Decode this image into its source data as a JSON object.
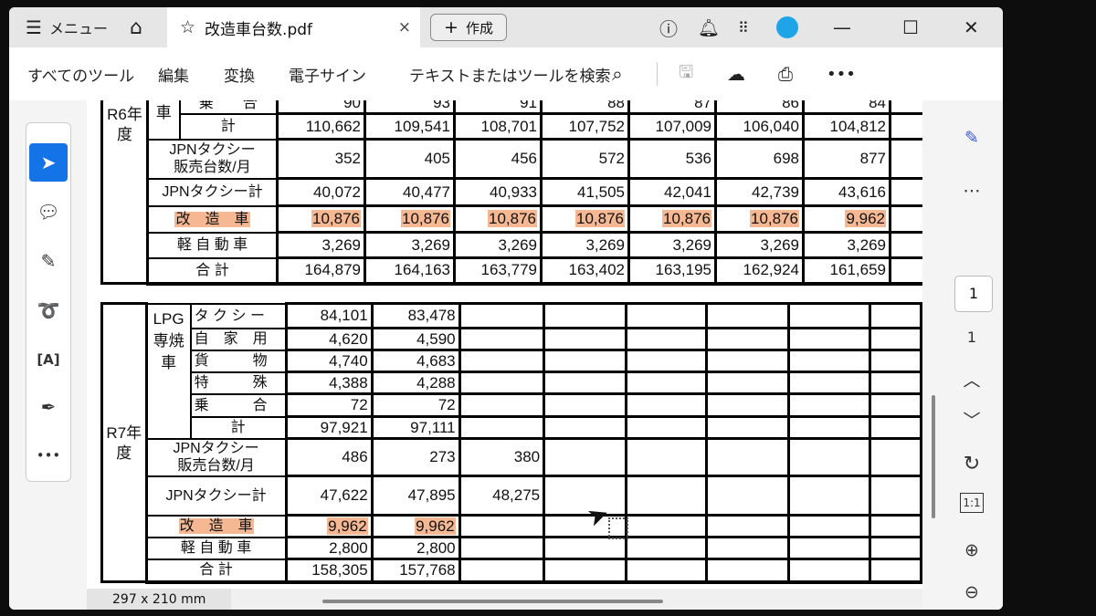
{
  "tabbar": {
    "menu_label": "メニュー",
    "tab_title": "改造車台数.pdf",
    "close": "×",
    "create_label": "作成"
  },
  "toolbar": {
    "all_tools": "すべてのツール",
    "edit": "編集",
    "convert": "変換",
    "esign": "電子サイン",
    "search_placeholder": "テキストまたはツールを検索"
  },
  "colors": {
    "accent": "#1473e6",
    "highlight": "#f6b892"
  },
  "r6": {
    "year_label": "R6年度",
    "sub_label": "車",
    "partial_row": {
      "label": "乗　　合",
      "values": [
        "90",
        "93",
        "91",
        "88",
        "87",
        "86",
        "84"
      ]
    },
    "rows": [
      {
        "label": "計",
        "values": [
          "110,662",
          "109,541",
          "108,701",
          "107,752",
          "107,009",
          "106,040",
          "104,812"
        ]
      },
      {
        "label": "JPNタクシー\n販売台数/月",
        "values": [
          "352",
          "405",
          "456",
          "572",
          "536",
          "698",
          "877"
        ]
      },
      {
        "label": "JPNタクシー計",
        "values": [
          "40,072",
          "40,477",
          "40,933",
          "41,505",
          "42,041",
          "42,739",
          "43,616"
        ]
      },
      {
        "label": "改　造　車",
        "values": [
          "10,876",
          "10,876",
          "10,876",
          "10,876",
          "10,876",
          "10,876",
          "9,962"
        ],
        "highlight": true
      },
      {
        "label": "軽 自 動 車",
        "values": [
          "3,269",
          "3,269",
          "3,269",
          "3,269",
          "3,269",
          "3,269",
          "3,269"
        ]
      },
      {
        "label": "合 計",
        "values": [
          "164,879",
          "164,163",
          "163,779",
          "163,402",
          "163,195",
          "162,924",
          "161,659"
        ]
      }
    ]
  },
  "r7": {
    "year_label": "R7年度",
    "lpg_label": "LPG専焼車",
    "lpg_rows": [
      {
        "label": "タ ク シ ー",
        "values": [
          "84,101",
          "83,478"
        ]
      },
      {
        "label": "自　家　用",
        "values": [
          "4,620",
          "4,590"
        ]
      },
      {
        "label": "貨　　　物",
        "values": [
          "4,740",
          "4,683"
        ]
      },
      {
        "label": "特　　　殊",
        "values": [
          "4,388",
          "4,288"
        ]
      },
      {
        "label": "乗　　　合",
        "values": [
          "72",
          "72"
        ]
      },
      {
        "label": "計",
        "values": [
          "97,921",
          "97,111"
        ]
      }
    ],
    "rows": [
      {
        "label": "JPNタクシー\n販売台数/月",
        "values": [
          "486",
          "273",
          "380"
        ]
      },
      {
        "label": "JPNタクシー計",
        "values": [
          "47,622",
          "47,895",
          "48,275"
        ]
      },
      {
        "label": "改　造　車",
        "values": [
          "9,962",
          "9,962"
        ],
        "highlight": true
      },
      {
        "label": "軽 自 動 車",
        "values": [
          "2,800",
          "2,800"
        ]
      },
      {
        "label": "合 計",
        "values": [
          "158,305",
          "157,768"
        ]
      }
    ]
  },
  "status": {
    "page_size": "297 x 210 mm"
  },
  "right_panel": {
    "page_input": "1",
    "page_total": "1"
  }
}
